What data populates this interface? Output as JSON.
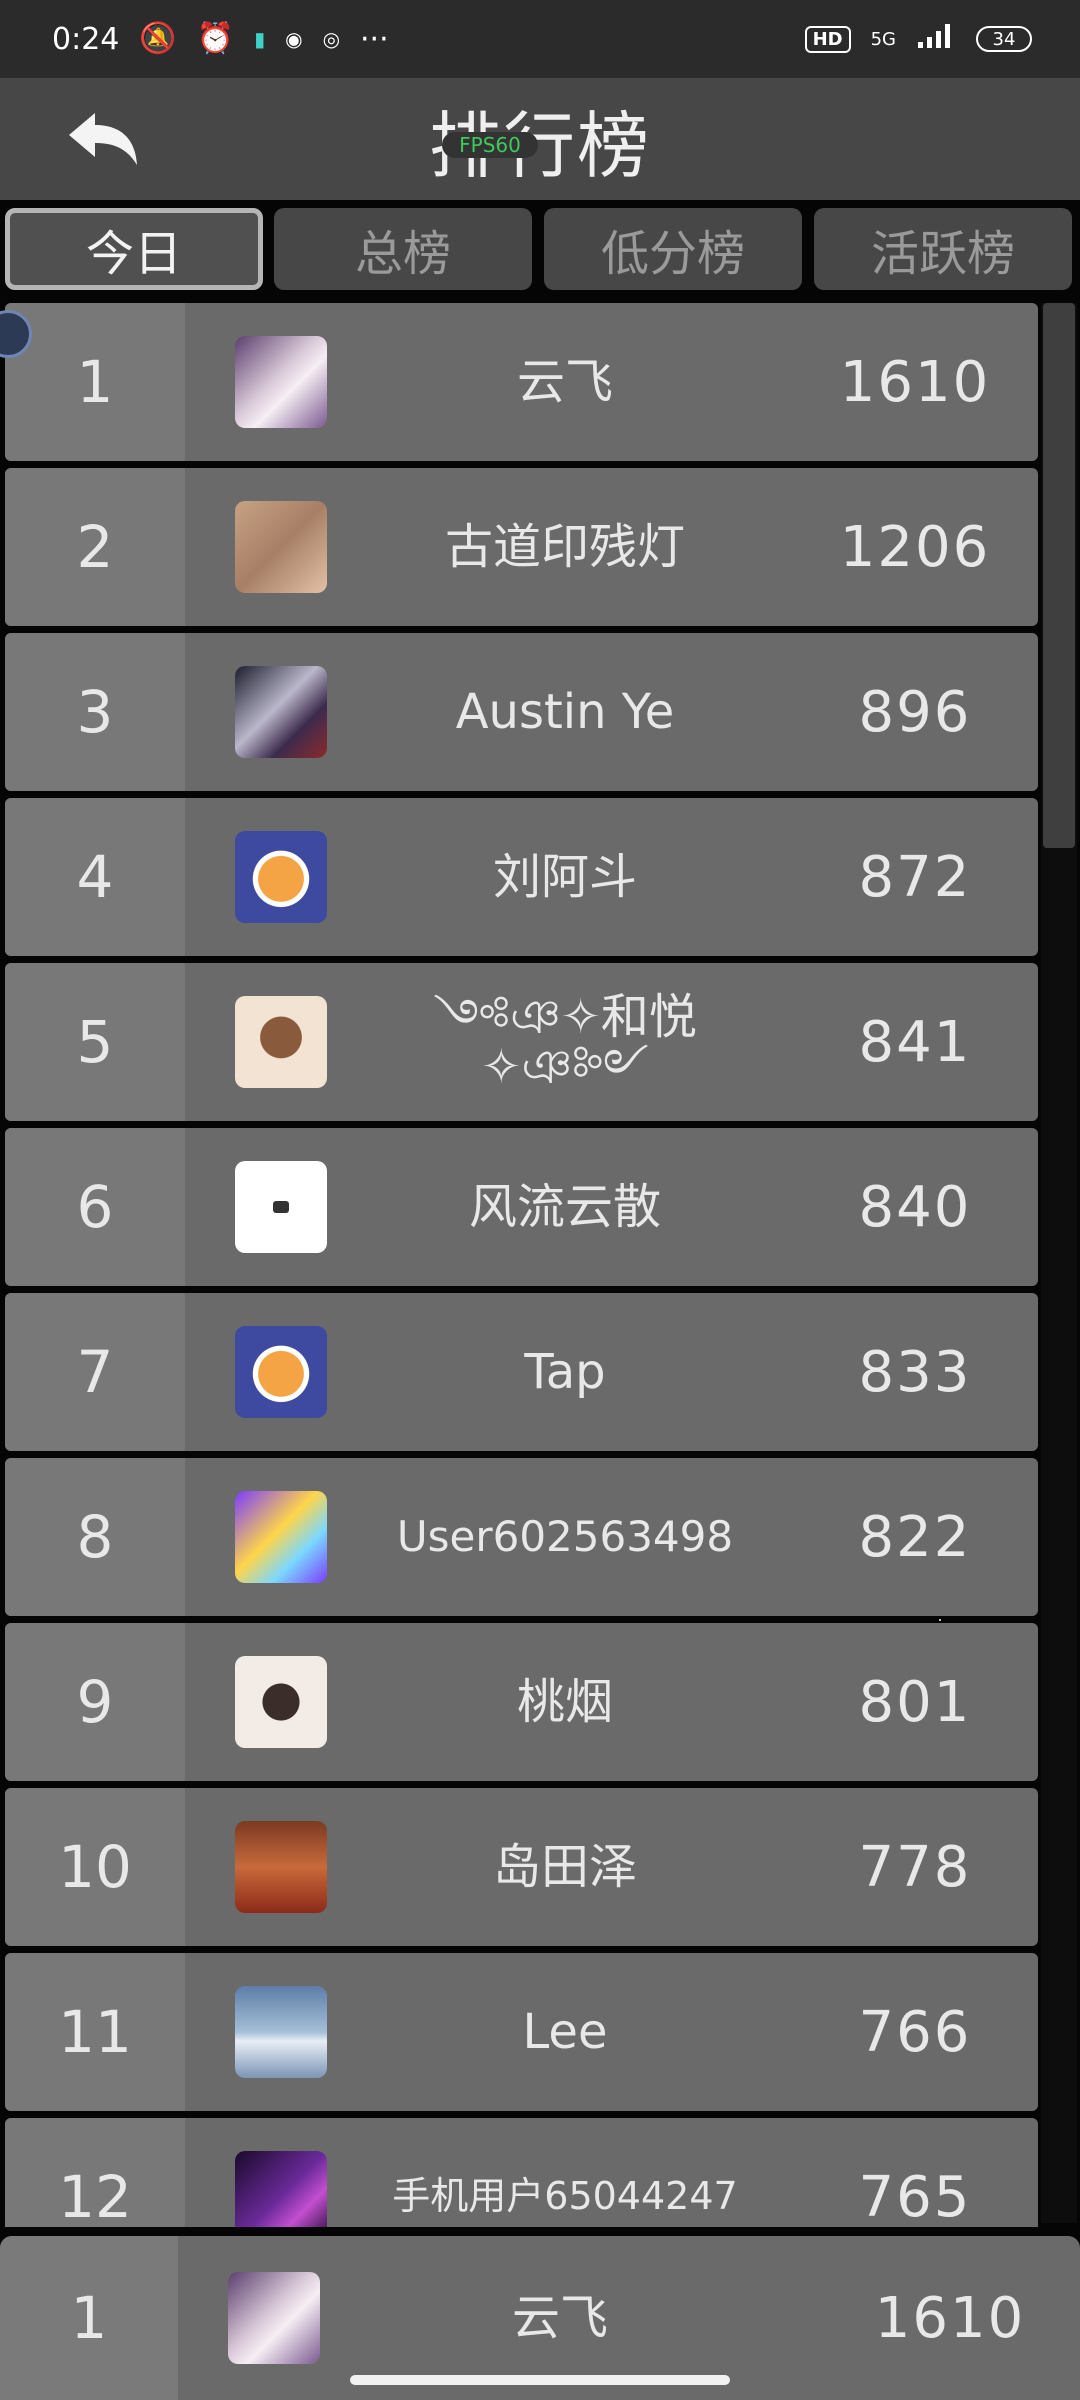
{
  "status_bar": {
    "time": "0:24",
    "network": "5G",
    "hd": "HD",
    "battery": "34",
    "more": "···"
  },
  "header": {
    "title": "排行榜",
    "fps": "FPS60"
  },
  "tabs": [
    {
      "label": "今日",
      "active": true
    },
    {
      "label": "总榜",
      "active": false
    },
    {
      "label": "低分榜",
      "active": false
    },
    {
      "label": "活跃榜",
      "active": false
    }
  ],
  "rows": [
    {
      "rank": "1",
      "name": "云飞",
      "score": "1610"
    },
    {
      "rank": "2",
      "name": "古道印残灯",
      "score": "1206"
    },
    {
      "rank": "3",
      "name": "Austin Ye",
      "score": "896"
    },
    {
      "rank": "4",
      "name": "刘阿斗",
      "score": "872"
    },
    {
      "rank": "5",
      "name": "༺ঞ✧和悦✧ঞ༻",
      "score": "841"
    },
    {
      "rank": "6",
      "name": "风流云散",
      "score": "840"
    },
    {
      "rank": "7",
      "name": "Tap",
      "score": "833"
    },
    {
      "rank": "8",
      "name": "User602563498",
      "score": "822"
    },
    {
      "rank": "9",
      "name": "桃烟",
      "score": "801"
    },
    {
      "rank": "10",
      "name": "岛田泽",
      "score": "778"
    },
    {
      "rank": "11",
      "name": "Lee",
      "score": "766"
    },
    {
      "rank": "12",
      "name": "手机用户65044247",
      "score": "765"
    }
  ],
  "self": {
    "rank": "1",
    "name": "云飞",
    "score": "1610"
  }
}
